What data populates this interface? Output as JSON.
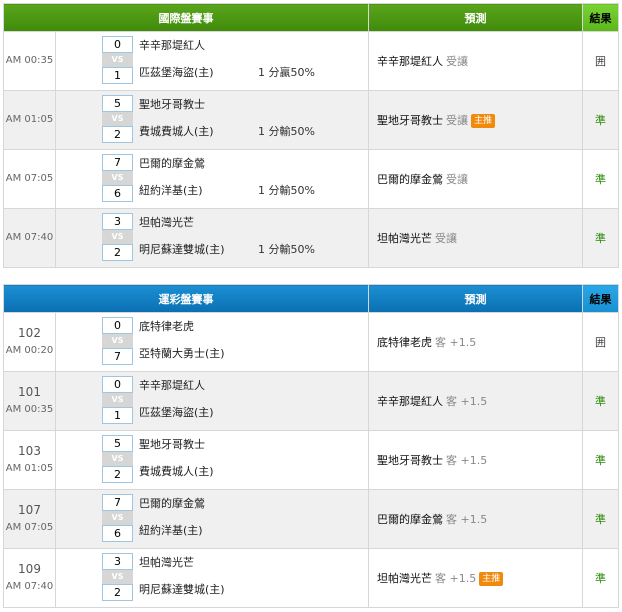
{
  "international": {
    "header": {
      "match": "國際盤賽事",
      "prediction": "預測",
      "result": "結果"
    },
    "rows": [
      {
        "time": "AM 00:35",
        "s1": "0",
        "s2": "1",
        "vs": "VS",
        "team1": "辛辛那堤紅人",
        "team2": "匹茲堡海盜(主)",
        "hcap": "1 分贏50%",
        "pred": "辛辛那堤紅人",
        "extra": "受讓",
        "badge": "",
        "result": "囲",
        "result_type": "pending"
      },
      {
        "time": "AM 01:05",
        "s1": "5",
        "s2": "2",
        "vs": "VS",
        "team1": "聖地牙哥教士",
        "team2": "費城費城人(主)",
        "hcap": "1 分輸50%",
        "pred": "聖地牙哥教士",
        "extra": "受讓",
        "badge": "主推",
        "result": "準",
        "result_type": "win"
      },
      {
        "time": "AM 07:05",
        "s1": "7",
        "s2": "6",
        "vs": "VS",
        "team1": "巴爾的摩金鶯",
        "team2": "紐約洋基(主)",
        "hcap": "1 分輸50%",
        "pred": "巴爾的摩金鶯",
        "extra": "受讓",
        "badge": "",
        "result": "準",
        "result_type": "win"
      },
      {
        "time": "AM 07:40",
        "s1": "3",
        "s2": "2",
        "vs": "VS",
        "team1": "坦帕灣光芒",
        "team2": "明尼蘇達雙城(主)",
        "hcap": "1 分輸50%",
        "pred": "坦帕灣光芒",
        "extra": "受讓",
        "badge": "",
        "result": "準",
        "result_type": "win"
      }
    ]
  },
  "lottery": {
    "header": {
      "match": "運彩盤賽事",
      "prediction": "預測",
      "result": "結果"
    },
    "rows": [
      {
        "num": "102",
        "time": "AM 00:20",
        "s1": "0",
        "s2": "7",
        "vs": "VS",
        "team1": "底特律老虎",
        "team2": "亞特蘭大勇士(主)",
        "pred": "底特律老虎",
        "extra": "客 +1.5",
        "badge": "",
        "result": "囲",
        "result_type": "pending"
      },
      {
        "num": "101",
        "time": "AM 00:35",
        "s1": "0",
        "s2": "1",
        "vs": "VS",
        "team1": "辛辛那堤紅人",
        "team2": "匹茲堡海盜(主)",
        "pred": "辛辛那堤紅人",
        "extra": "客 +1.5",
        "badge": "",
        "result": "準",
        "result_type": "win"
      },
      {
        "num": "103",
        "time": "AM 01:05",
        "s1": "5",
        "s2": "2",
        "vs": "VS",
        "team1": "聖地牙哥教士",
        "team2": "費城費城人(主)",
        "pred": "聖地牙哥教士",
        "extra": "客 +1.5",
        "badge": "",
        "result": "準",
        "result_type": "win"
      },
      {
        "num": "107",
        "time": "AM 07:05",
        "s1": "7",
        "s2": "6",
        "vs": "VS",
        "team1": "巴爾的摩金鶯",
        "team2": "紐約洋基(主)",
        "pred": "巴爾的摩金鶯",
        "extra": "客 +1.5",
        "badge": "",
        "result": "準",
        "result_type": "win"
      },
      {
        "num": "109",
        "time": "AM 07:40",
        "s1": "3",
        "s2": "2",
        "vs": "VS",
        "team1": "坦帕灣光芒",
        "team2": "明尼蘇達雙城(主)",
        "pred": "坦帕灣光芒",
        "extra": "客 +1.5",
        "badge": "主推",
        "result": "準",
        "result_type": "win"
      }
    ]
  },
  "colors": {
    "intl_header": "#4a9a12",
    "lottery_header": "#127fc4",
    "win": "#2d8c0a",
    "badge": "#f08a0c"
  }
}
